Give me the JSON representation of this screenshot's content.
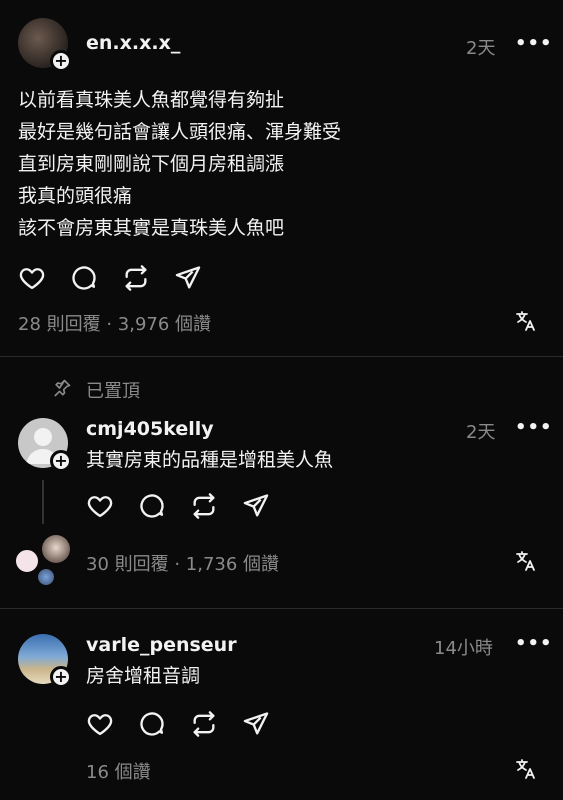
{
  "post": {
    "username": "en.x.x.x_",
    "time": "2天",
    "more": "•••",
    "body": "以前看真珠美人魚都覺得有夠扯\n最好是幾句話會讓人頭很痛、渾身難受\n直到房東剛剛說下個月房租調漲\n我真的頭很痛\n該不會房東其實是真珠美人魚吧",
    "stats": "28 則回覆 · 3,976 個讚"
  },
  "pinned": {
    "label": "已置頂"
  },
  "comment1": {
    "username": "cmj405kelly",
    "time": "2天",
    "more": "•••",
    "body": "其實房東的品種是增租美人魚",
    "stats": "30 則回覆 · 1,736 個讚"
  },
  "comment2": {
    "username": "varle_penseur",
    "time": "14小時",
    "more": "•••",
    "body": "房舍增租音調",
    "stats": "16 個讚"
  },
  "icons": {
    "like": "heart-icon",
    "comment": "comment-icon",
    "repost": "repost-icon",
    "share": "send-icon",
    "translate": "translate-icon",
    "pin": "pin-icon"
  },
  "colors": {
    "background": "#0a0a0a",
    "text": "#f2f2f2",
    "muted": "#8a8a8a"
  }
}
